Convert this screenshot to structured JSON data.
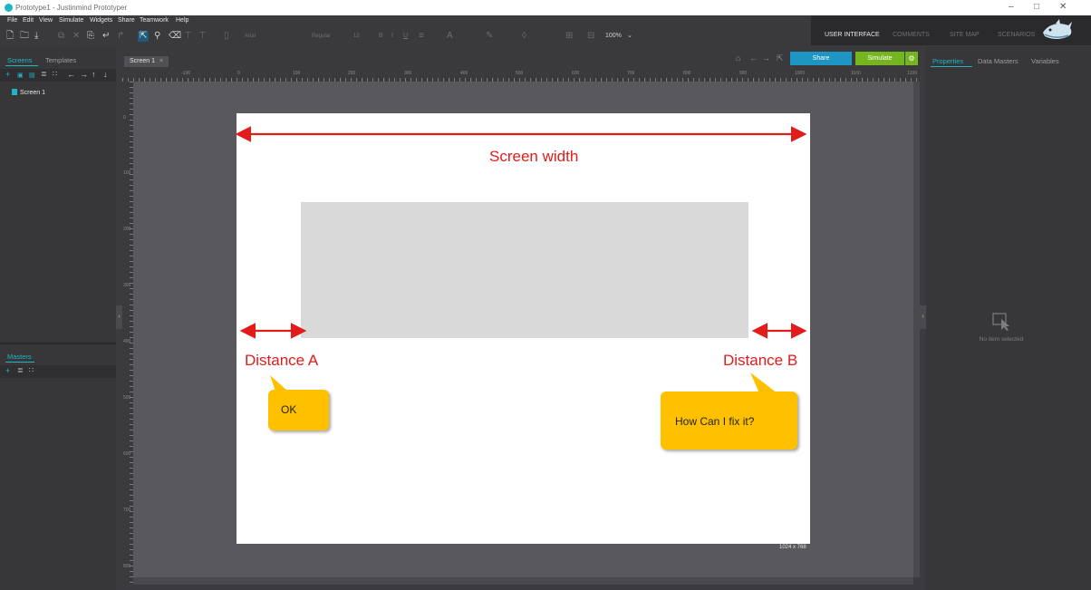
{
  "window": {
    "title": "Prototype1 - Justinmind Prototyper",
    "controls": [
      "–",
      "□",
      "✕"
    ]
  },
  "menu": [
    "File",
    "Edit",
    "View",
    "Simulate",
    "Widgets",
    "Share",
    "Teamwork",
    "Help"
  ],
  "toolbar": {
    "font_family": "Arial",
    "font_style": "Regular",
    "font_size": "12",
    "bold": "B",
    "italic": "I",
    "underline": "U",
    "text_a": "A",
    "zoom": "100%"
  },
  "view_tabs": [
    "USER INTERFACE",
    "COMMENTS",
    "SITE MAP",
    "SCENARIOS"
  ],
  "active_view_tab": "USER INTERFACE",
  "left_panel": {
    "tabs": [
      "Screens",
      "Templates"
    ],
    "screens": [
      "Screen 1"
    ],
    "masters_tab": "Masters"
  },
  "editor": {
    "tab": "Screen 1",
    "tab_close": "×",
    "share": "Share",
    "simulate": "Simulate",
    "screen_size": "1024 x 768",
    "ruler_top": [
      "-100",
      "0",
      "100",
      "200",
      "300",
      "400",
      "500",
      "600",
      "700",
      "800",
      "900",
      "1000",
      "1100",
      "1200"
    ],
    "ruler_left": [
      "0",
      "100",
      "200",
      "300",
      "400",
      "500",
      "600",
      "700",
      "800"
    ]
  },
  "annotations": {
    "screen_width": "Screen width",
    "distance_a": "Distance A",
    "distance_b": "Distance B",
    "callout_ok": "OK",
    "callout_question": "How Can I fix it?"
  },
  "right_panel": {
    "tabs": [
      "Properties",
      "Data Masters",
      "Variables"
    ],
    "empty_state": "No item selected"
  },
  "colors": {
    "accent_teal": "#1fb6c3",
    "share_blue": "#1d96c4",
    "simulate_green": "#75b51f",
    "annotation_red": "#e21b1b",
    "callout_yellow": "#ffc000"
  }
}
